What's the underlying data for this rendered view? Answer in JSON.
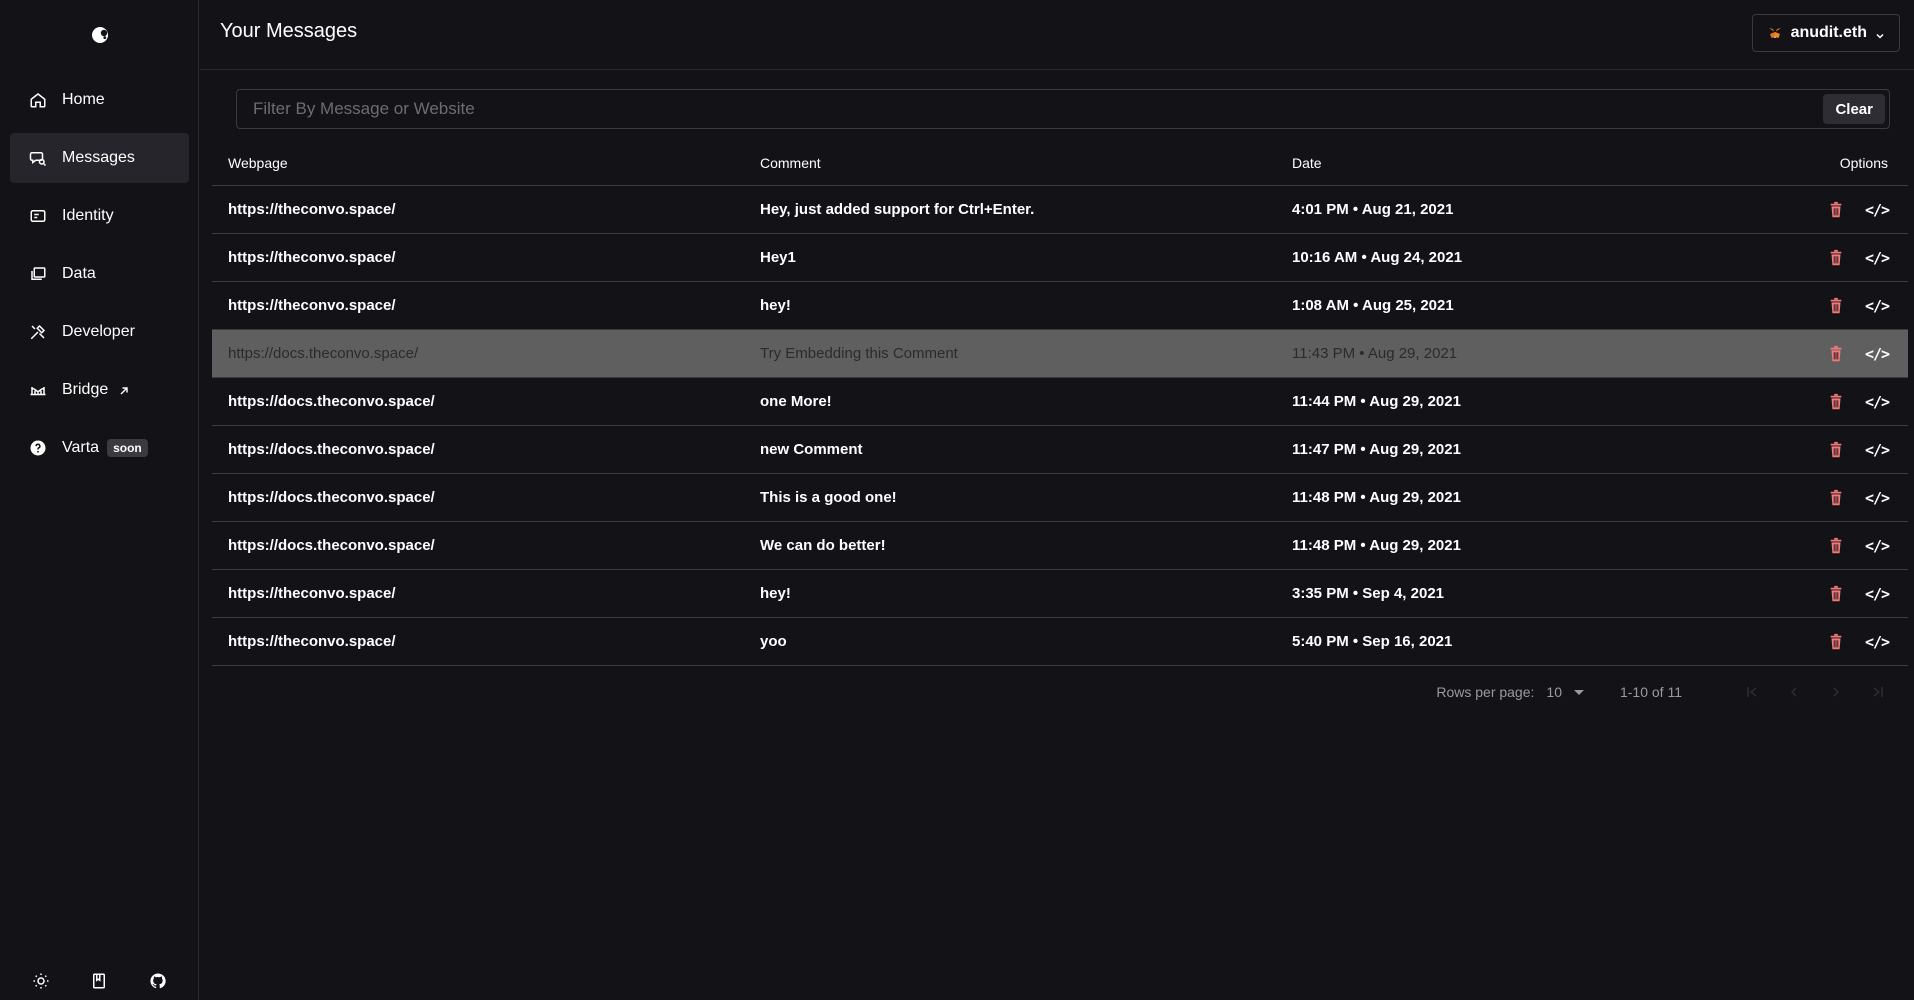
{
  "app": {
    "page_title": "Your Messages"
  },
  "account": {
    "name": "anudit.eth"
  },
  "sidebar": {
    "items": [
      {
        "label": "Home",
        "icon": "home-icon",
        "active": false
      },
      {
        "label": "Messages",
        "icon": "messages-icon",
        "active": true
      },
      {
        "label": "Identity",
        "icon": "identity-icon",
        "active": false
      },
      {
        "label": "Data",
        "icon": "data-icon",
        "active": false
      },
      {
        "label": "Developer",
        "icon": "developer-icon",
        "active": false
      },
      {
        "label": "Bridge",
        "icon": "bridge-icon",
        "active": false
      },
      {
        "label": "Varta",
        "icon": "help-icon",
        "active": false,
        "badge": "soon"
      }
    ],
    "footer_icons": [
      "sun-icon",
      "book-icon",
      "github-icon"
    ]
  },
  "filter": {
    "placeholder": "Filter By Message or Website",
    "value": "",
    "clear_label": "Clear"
  },
  "table": {
    "columns": [
      "Webpage",
      "Comment",
      "Date",
      "Options"
    ],
    "rows": [
      {
        "webpage": "https://theconvo.space/",
        "comment": "Hey, just added support for Ctrl+Enter.",
        "date": "4:01 PM • Aug 21, 2021"
      },
      {
        "webpage": "https://theconvo.space/",
        "comment": "Hey1",
        "date": "10:16 AM • Aug 24, 2021"
      },
      {
        "webpage": "https://theconvo.space/",
        "comment": "hey!",
        "date": "1:08 AM • Aug 25, 2021"
      },
      {
        "webpage": "https://docs.theconvo.space/",
        "comment": "Try Embedding this Comment",
        "date": "11:43 PM • Aug 29, 2021",
        "highlighted": true
      },
      {
        "webpage": "https://docs.theconvo.space/",
        "comment": "one More!",
        "date": "11:44 PM • Aug 29, 2021"
      },
      {
        "webpage": "https://docs.theconvo.space/",
        "comment": "new Comment",
        "date": "11:47 PM • Aug 29, 2021"
      },
      {
        "webpage": "https://docs.theconvo.space/",
        "comment": "This is a good one!",
        "date": "11:48 PM • Aug 29, 2021"
      },
      {
        "webpage": "https://docs.theconvo.space/",
        "comment": "We can do better!",
        "date": "11:48 PM • Aug 29, 2021"
      },
      {
        "webpage": "https://theconvo.space/",
        "comment": "hey!",
        "date": "3:35 PM • Sep 4, 2021"
      },
      {
        "webpage": "https://theconvo.space/",
        "comment": "yoo",
        "date": "5:40 PM • Sep 16, 2021"
      }
    ],
    "option_icons": [
      "trash-icon",
      "code-icon"
    ],
    "code_glyph": "</>"
  },
  "pagination": {
    "rows_per_page_label": "Rows per page:",
    "rows_per_page": "10",
    "range": "1-10 of 11"
  },
  "colors": {
    "background": "#131217",
    "highlight_row": "#5f5f5f",
    "trash": "#f07b7b",
    "border": "#3a3a40"
  }
}
